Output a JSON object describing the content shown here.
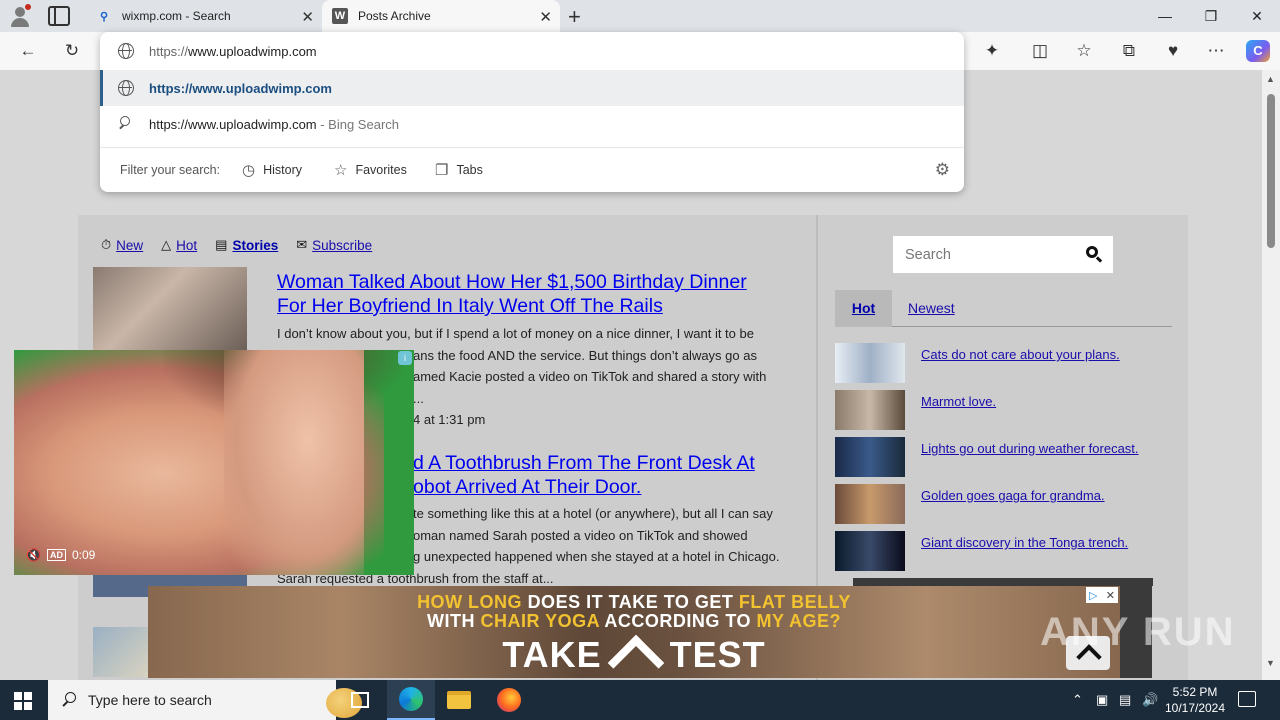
{
  "browser": {
    "tabs": [
      {
        "title": "wixmp.com - Search",
        "favicon": "search-icon"
      },
      {
        "title": "Posts Archive",
        "favicon": "w-logo-icon"
      }
    ],
    "address": {
      "typed_prefix": "https://",
      "typed_rest": "www.uploadwimp.com"
    },
    "suggestions": [
      {
        "text": "https://www.uploadwimp.com",
        "icon": "globe-icon"
      },
      {
        "text": "https://www.uploadwimp.com",
        "suffix": " - Bing Search",
        "icon": "search-icon"
      }
    ],
    "filter": {
      "label": "Filter your search:",
      "chips": [
        "History",
        "Favorites",
        "Tabs"
      ]
    }
  },
  "page": {
    "nav": [
      "New",
      "Hot",
      "Stories",
      "Subscribe"
    ],
    "posts": [
      {
        "title_line1": "Woman Talked About How Her $1,500 Birthday Dinner",
        "title_line2": "For Her Boyfriend In Italy Went Off The Rails",
        "body_line1": "I don’t know about you, but if I spend a lot of money on a nice dinner, I want it to be",
        "body_line2": "ans the food AND the service. But things don’t always go as",
        "body_line3": "amed Kacie posted a video on TikTok and shared a story with",
        "body_line4": "...",
        "meta": "4 at 1:31 pm"
      },
      {
        "title_line1": "d A Toothbrush From The Front Desk At",
        "title_line2": "obot Arrived At Their Door.",
        "body_line1": "te something like this at a hotel (or anywhere), but all I can say",
        "body_line2": "oman named Sarah posted a video on TikTok and showed",
        "body_line3": "g unexpected happened when she stayed at a hotel in Chicago.",
        "body_line4": "Sarah requested a toothbrush from the staff at..."
      }
    ],
    "sidebar": {
      "search_placeholder": "Search",
      "tabs": [
        "Hot",
        "Newest"
      ],
      "items": [
        "Cats do not care about your plans.",
        "Marmot love.",
        "Lights go out during weather forecast.",
        "Golden goes gaga for grandma.",
        "Giant discovery in the Tonga trench."
      ]
    },
    "video_ad": {
      "time": "0:09",
      "ad_label": "AD"
    },
    "banner_ad": {
      "line1_white": "HOW LONG ",
      "line1_yellow": "DOES IT TAKE TO GET ",
      "line1_white2": "FLAT BELLY",
      "line2_white": "WITH ",
      "line2_yellow": "CHAIR YOGA ",
      "line2_white2": "ACCORDING TO ",
      "line2_yellow2": "MY AGE?",
      "cta_left": "TAKE",
      "cta_right": "TEST"
    },
    "watermark": "ANY RUN"
  },
  "taskbar": {
    "search_placeholder": "Type here to search",
    "time": "5:52 PM",
    "date": "10/17/2024"
  }
}
